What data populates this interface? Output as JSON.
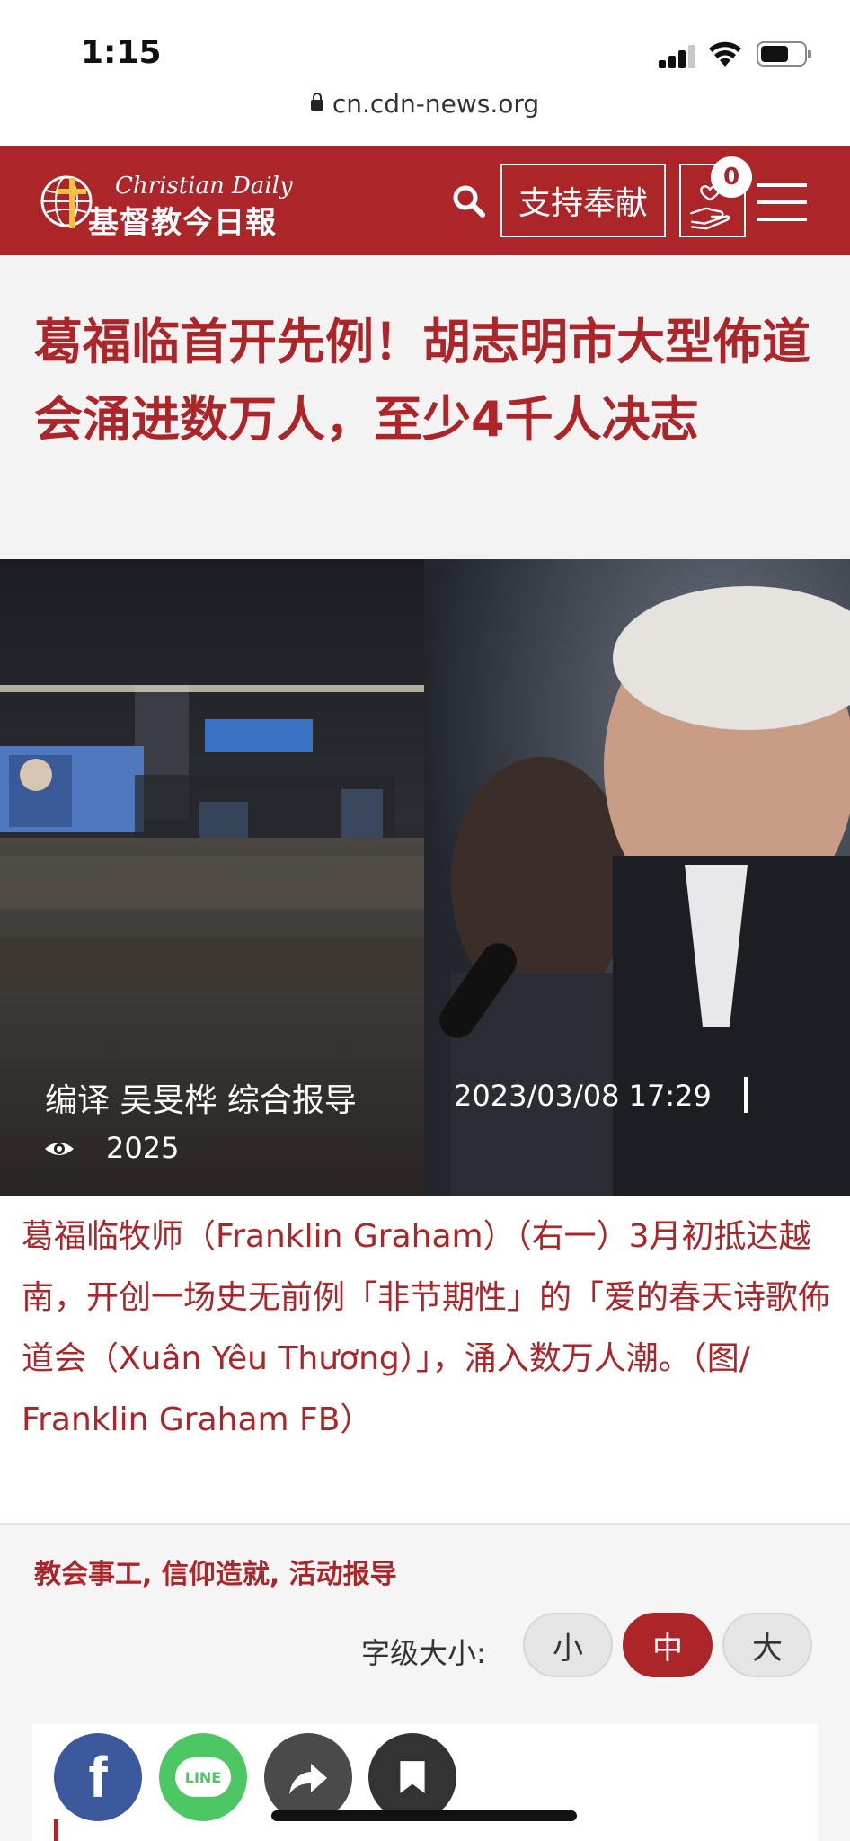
{
  "status_bar": {
    "time": "1:15"
  },
  "browser": {
    "url": "cn.cdn-news.org"
  },
  "header": {
    "logo_en": "Christian Daily",
    "logo_zh": "基督教今日報",
    "support_label": "支持奉献",
    "donate_count": "0",
    "brand_color": "#ab2529"
  },
  "article": {
    "title": "葛福临首开先例！胡志明市大型佈道会涌进数万人，至少4千人决志",
    "author": "编译 吴旻桦 综合报导",
    "date": "2023/03/08 17:29",
    "views": "2025",
    "caption": "葛福临牧师（Franklin Graham）（右一）3月初抵达越南，开创一场史无前例「非节期性」的「爱的春天诗歌佈道会（Xuân Yêu Thương）」，涌入数万人潮。（图/ Franklin Graham FB）",
    "categories": "教会事工, 信仰造就, 活动报导"
  },
  "font_size": {
    "label": "字级大小:",
    "options": [
      "小",
      "中",
      "大"
    ],
    "selected": "中"
  },
  "share": {
    "facebook_label": "f",
    "line_label": "LINE",
    "icons": [
      "facebook-icon",
      "line-icon",
      "forward-icon",
      "bookmark-icon"
    ]
  }
}
